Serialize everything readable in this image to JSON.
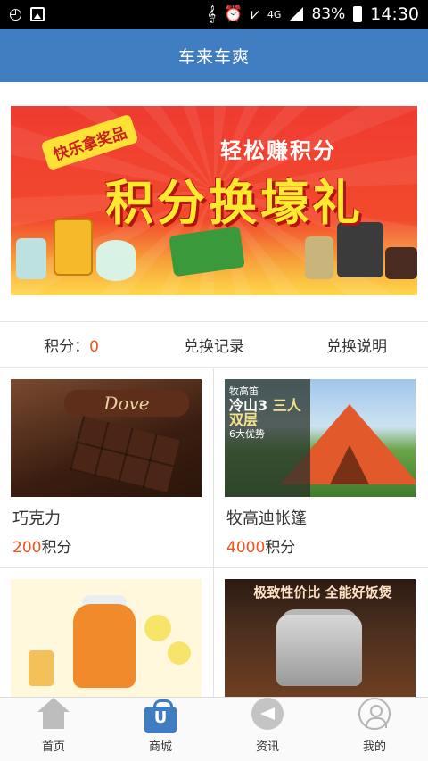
{
  "status_bar": {
    "battery": "83%",
    "time": "14:30",
    "network": "4G",
    "icons": [
      "camera-360-icon",
      "image-icon",
      "mute-icon",
      "alarm-icon",
      "wifi-icon",
      "signal-icon",
      "battery-icon"
    ]
  },
  "header": {
    "title": "车来车爽"
  },
  "banner": {
    "badge": "快乐拿奖品",
    "subtitle": "轻松赚积分",
    "title": "积分换壕礼"
  },
  "points_bar": {
    "label": "积分：",
    "value": "0",
    "history": "兑换记录",
    "rules": "兑换说明"
  },
  "products": [
    {
      "name": "巧克力",
      "points": "200",
      "unit": "积分",
      "image_text": "Dove"
    },
    {
      "name": "牧高迪帐篷",
      "points": "4000",
      "unit": "积分",
      "image_text": [
        "牧高笛",
        "冷山3",
        "三人双层",
        "6大优势"
      ]
    },
    {
      "name": "",
      "points": "",
      "unit": "",
      "image_text": ""
    },
    {
      "name": "",
      "points": "",
      "unit": "",
      "image_text": "极致性价比 全能好饭煲"
    }
  ],
  "bottom_nav": [
    {
      "label": "首页",
      "icon": "home-icon",
      "active": false
    },
    {
      "label": "商城",
      "icon": "shopping-bag-icon",
      "active": true
    },
    {
      "label": "资讯",
      "icon": "megaphone-icon",
      "active": false
    },
    {
      "label": "我的",
      "icon": "user-icon",
      "active": false
    }
  ],
  "colors": {
    "primary": "#3f7cc0",
    "accent": "#f4511e"
  }
}
